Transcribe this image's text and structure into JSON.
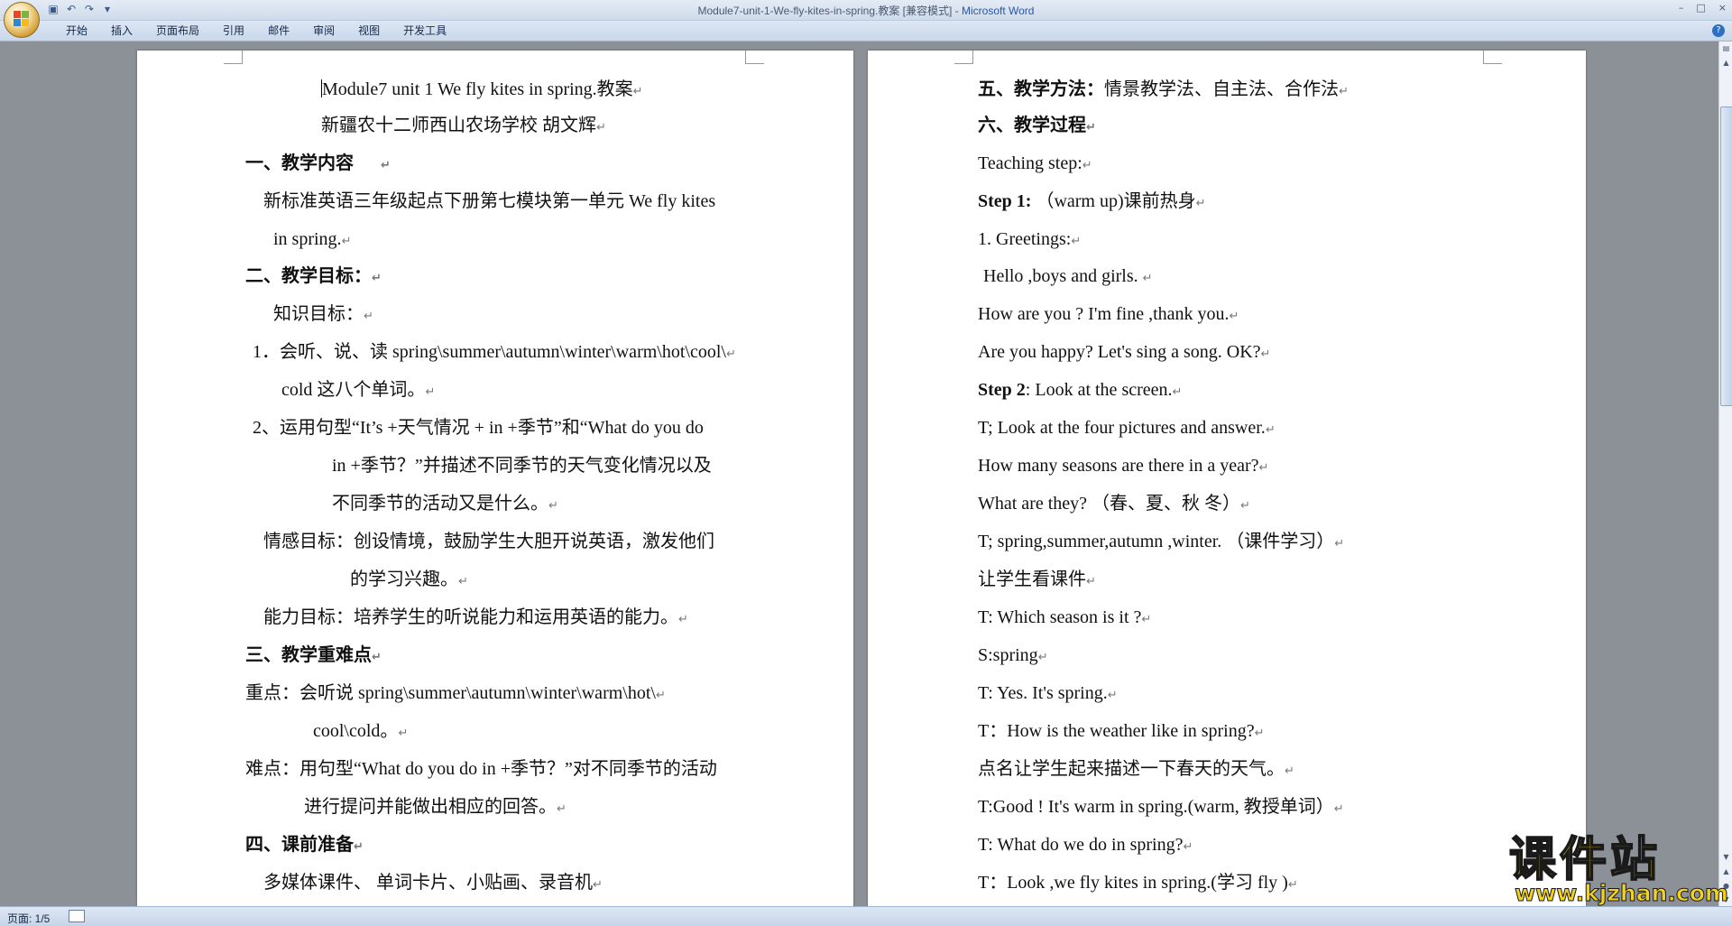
{
  "window": {
    "title": "Module7-unit-1-We-fly-kites-in-spring.教案 [兼容模式] - ",
    "app_name": "Microsoft Word",
    "controls": [
      "–",
      "□",
      "×"
    ]
  },
  "ribbon_tabs": [
    "开始",
    "插入",
    "页面布局",
    "引用",
    "邮件",
    "审阅",
    "视图",
    "开发工具"
  ],
  "help_label": "?",
  "paragraph_mark": "↵",
  "left_page": {
    "title": "Module7 unit 1    We fly kites in spring.教案",
    "author": "新疆农十二师西山农场学校          胡文辉",
    "s1": "一、教学内容",
    "s1_a": "新标准英语三年级起点下册第七模块第一单元 We fly kites",
    "s1_b": "in spring.",
    "s2": "二、教学目标：",
    "s2_k": "知识目标：",
    "s2_k1a": "1．会听、说、读 spring\\summer\\autumn\\winter\\warm\\hot\\cool\\",
    "s2_k1b": "cold 这八个单词。",
    "s2_k2a": "2、运用句型“It’s +天气情况  + in +季节”和“What do you do",
    "s2_k2b": "in  +季节？”并描述不同季节的天气变化情况以及",
    "s2_k2c": "不同季节的活动又是什么。",
    "s2_e_a": "情感目标：创设情境，鼓励学生大胆开说英语，激发他们",
    "s2_e_b": "的学习兴趣。",
    "s2_ab": "能力目标：培养学生的听说能力和运用英语的能力。",
    "s3": "三、教学重难点",
    "s3_z_a": "重点：会听说 spring\\summer\\autumn\\winter\\warm\\hot\\",
    "s3_z_b": "cool\\cold。",
    "s3_n_a": "难点：用句型“What do you do in +季节？”对不同季节的活动",
    "s3_n_b": "进行提问并能做出相应的回答。",
    "s4": "四、课前准备",
    "s4_a": "多媒体课件、  单词卡片、小贴画、录音机"
  },
  "right_page": {
    "s5_head": "五、教学方法：",
    "s5_body": "情景教学法、自主法、合作法",
    "s6": "六、教学过程",
    "r1": "Teaching step:",
    "r2_b": "Step 1:",
    "r2": "  （warm up)课前热身",
    "r3": "1. Greetings:",
    "r4": " Hello ,boys and girls.  ",
    "r5": "How are you ? I'm fine ,thank you.",
    "r6": "Are you happy? Let's sing a song. OK?",
    "r7_b": "Step 2",
    "r7": ": Look at the screen.",
    "r8": "T; Look at the four pictures and answer.",
    "r9": "How many seasons are there in a year?",
    "r10": "What are they?  （春、夏、秋  冬）",
    "r11": "T; spring,summer,autumn  ,winter.  （课件学习）",
    "r12": "让学生看课件",
    "r13": "T: Which season is it ?",
    "r14": "S:spring",
    "r15": "T: Yes. It's spring.",
    "r16": "T：How is the weather like in spring?",
    "r17": "点名让学生起来描述一下春天的天气。",
    "r18": "T:Good ! It's warm in spring.(warm,  教授单词）",
    "r19": "T: What do we do in spring?",
    "r20": "T：Look ,we fly kites in spring.(学习 fly )"
  },
  "status": {
    "page": "页面: 1/5"
  },
  "watermark": {
    "cn": "课件站",
    "url": "www.kjzhan.com"
  },
  "colors": {
    "app_blue": "#2b56a4",
    "watermark_yellow": "#f3d21c",
    "chrome": "#dde7f4"
  }
}
